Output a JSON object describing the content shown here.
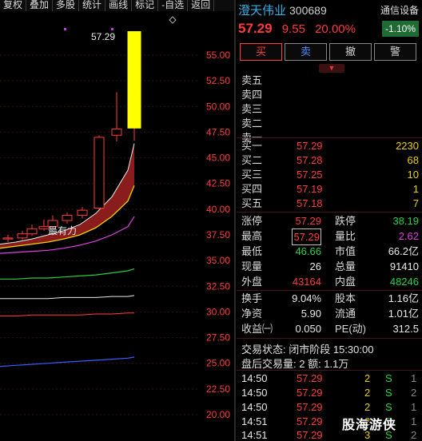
{
  "toolbar": {
    "items": [
      "复权",
      "叠加",
      "多股",
      "统计",
      "画线",
      "标记",
      "-自选",
      "返回"
    ]
  },
  "chart": {
    "y_labels": [
      "55.00",
      "52.50",
      "50.00",
      "47.50",
      "45.00",
      "42.50",
      "40.00",
      "37.50",
      "35.00",
      "32.50",
      "30.00",
      "27.50",
      "25.00",
      "22.50",
      "20.00"
    ],
    "high_label": "57.29",
    "annotation": "最有力"
  },
  "chart_data": {
    "type": "candlestick",
    "ylim": [
      20.0,
      57.29
    ],
    "candles": [
      {
        "o": 37.1,
        "c": 37.2,
        "h": 37.5,
        "l": 36.8
      },
      {
        "o": 37.2,
        "c": 37.6,
        "h": 37.9,
        "l": 37.0
      },
      {
        "o": 37.6,
        "c": 38.1,
        "h": 38.5,
        "l": 37.4
      },
      {
        "o": 38.1,
        "c": 38.3,
        "h": 39.0,
        "l": 37.9
      },
      {
        "o": 38.3,
        "c": 38.9,
        "h": 39.4,
        "l": 38.1
      },
      {
        "o": 38.9,
        "c": 39.4,
        "h": 39.7,
        "l": 38.6
      },
      {
        "o": 39.4,
        "c": 39.9,
        "h": 40.2,
        "l": 39.1
      },
      {
        "o": 40.1,
        "c": 47.0,
        "h": 47.2,
        "l": 40.0
      },
      {
        "o": 47.2,
        "c": 47.8,
        "h": 51.4,
        "l": 46.6
      },
      {
        "o": 47.9,
        "c": 57.29,
        "h": 57.29,
        "l": 46.66
      }
    ],
    "limit_up_index": 9
  },
  "header": {
    "name": "澄天伟业",
    "code": "300689",
    "sector": "通信设备",
    "price": "57.29",
    "change": "9.55",
    "pct": "20.00%",
    "sector_pct": "-1.10%"
  },
  "buttons": {
    "buy": "买",
    "sell": "卖",
    "cancel": "撤",
    "alert": "警"
  },
  "asks": [
    {
      "label": "卖五",
      "price": "",
      "vol": ""
    },
    {
      "label": "卖四",
      "price": "",
      "vol": ""
    },
    {
      "label": "卖三",
      "price": "",
      "vol": ""
    },
    {
      "label": "卖二",
      "price": "",
      "vol": ""
    },
    {
      "label": "卖一",
      "price": "",
      "vol": ""
    }
  ],
  "bids": [
    {
      "label": "买一",
      "price": "57.29",
      "vol": "2230"
    },
    {
      "label": "买二",
      "price": "57.28",
      "vol": "68"
    },
    {
      "label": "买三",
      "price": "57.25",
      "vol": "10"
    },
    {
      "label": "买四",
      "price": "57.19",
      "vol": "1"
    },
    {
      "label": "买五",
      "price": "57.18",
      "vol": "7"
    }
  ],
  "stats": {
    "limit_up_label": "涨停",
    "limit_up": "57.29",
    "limit_down_label": "跌停",
    "limit_down": "38.19",
    "high_label": "最高",
    "high": "57.29",
    "vol_ratio_label": "量比",
    "vol_ratio": "2.62",
    "low_label": "最低",
    "low": "46.66",
    "mcap_label": "市值",
    "mcap": "66.2亿",
    "cur_label": "现量",
    "cur": "26",
    "total_label": "总量",
    "total": "91410",
    "outer_label": "外盘",
    "outer": "43164",
    "inner_label": "内盘",
    "inner": "48246",
    "turnover_label": "换手",
    "turnover": "9.04%",
    "shares_label": "股本",
    "shares": "1.16亿",
    "nav_label": "净资",
    "nav": "5.90",
    "float_label": "流通",
    "float": "1.01亿",
    "eps_label": "收益㈠",
    "eps": "0.050",
    "pe_label": "PE(动)",
    "pe": "312.5"
  },
  "status": {
    "line1": "交易状态: 闭市阶段 15:30:00",
    "line2": "盘后交易量: 2  额: 1.1万"
  },
  "ticks": [
    {
      "time": "14:50",
      "price": "57.29",
      "vol": "2",
      "side": "S",
      "n": "1"
    },
    {
      "time": "14:50",
      "price": "57.29",
      "vol": "2",
      "side": "S",
      "n": "2"
    },
    {
      "time": "14:50",
      "price": "57.29",
      "vol": "2",
      "side": "S",
      "n": "1"
    },
    {
      "time": "14:51",
      "price": "57.29",
      "vol": "2",
      "side": "S",
      "n": "1"
    },
    {
      "time": "14:51",
      "price": "57.29",
      "vol": "3",
      "side": "S",
      "n": "2"
    }
  ],
  "watermark": "股海游侠"
}
